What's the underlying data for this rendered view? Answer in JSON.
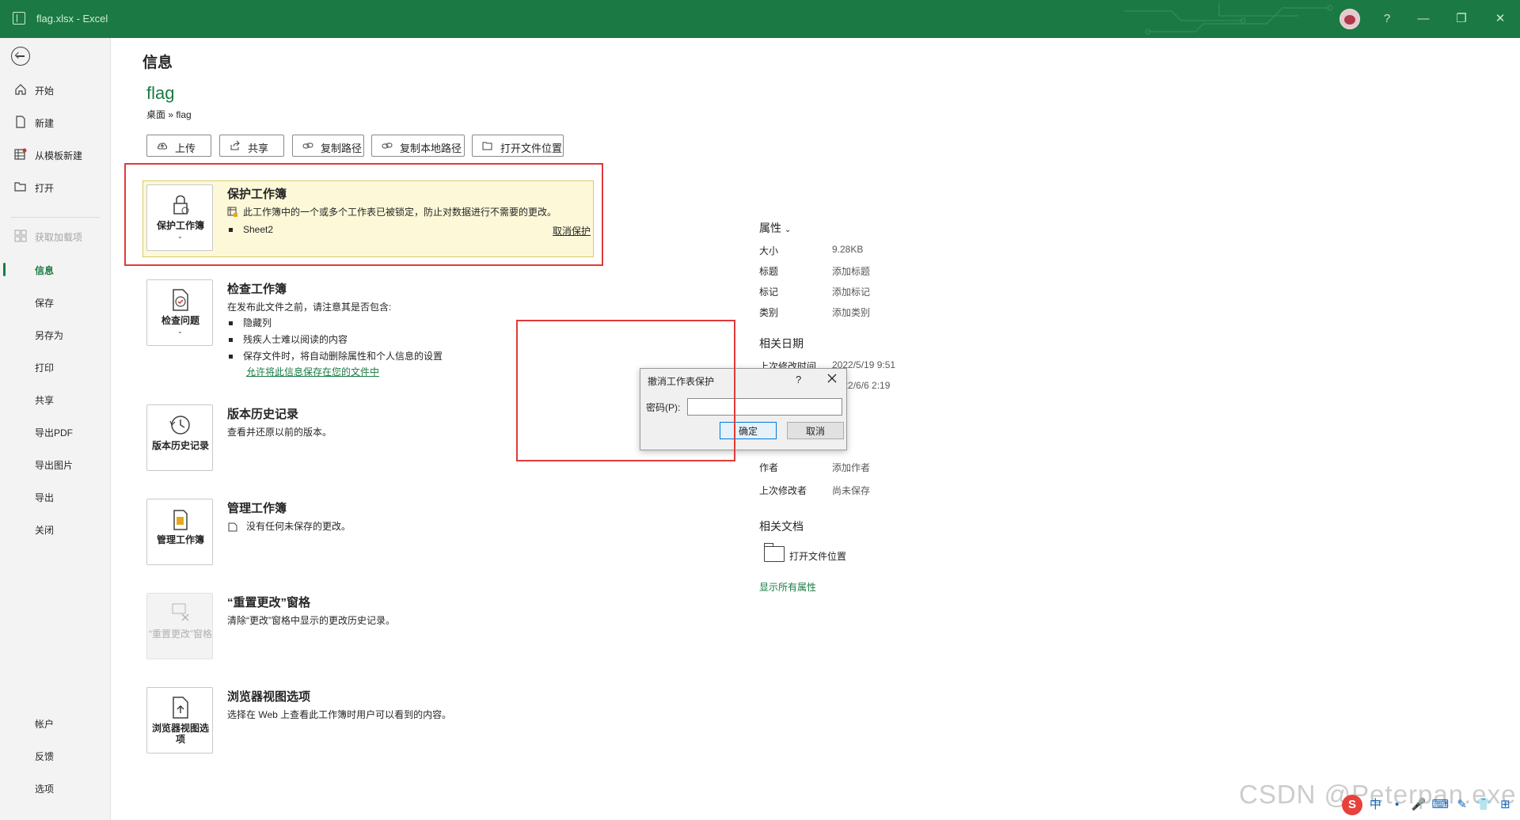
{
  "window": {
    "title": "flag.xlsx  -  Excel",
    "help": "?",
    "minimize": "—",
    "restore": "❐",
    "close": "✕",
    "accent_color": "#1b7a43"
  },
  "nav": {
    "items": [
      {
        "label": "开始",
        "icon": "home-icon"
      },
      {
        "label": "新建",
        "icon": "new-document-icon"
      },
      {
        "label": "从模板新建",
        "icon": "template-icon"
      },
      {
        "label": "打开",
        "icon": "open-folder-icon"
      },
      {
        "label": "获取加载项",
        "icon": "addins-icon"
      },
      {
        "label": "信息"
      },
      {
        "label": "保存"
      },
      {
        "label": "另存为"
      },
      {
        "label": "打印"
      },
      {
        "label": "共享"
      },
      {
        "label": "导出PDF"
      },
      {
        "label": "导出图片"
      },
      {
        "label": "导出"
      },
      {
        "label": "关闭"
      },
      {
        "label": "帐户"
      },
      {
        "label": "反馈"
      },
      {
        "label": "选项"
      }
    ]
  },
  "main": {
    "heading": "信息",
    "file_name": "flag",
    "breadcrumb": "桌面 » flag",
    "buttons": [
      {
        "label": "上传",
        "icon": "upload-icon"
      },
      {
        "label": "共享",
        "icon": "share-icon"
      },
      {
        "label": "复制路径",
        "icon": "link-icon"
      },
      {
        "label": "复制本地路径",
        "icon": "link-icon"
      },
      {
        "label": "打开文件位置",
        "icon": "open-folder-icon"
      }
    ],
    "protect": {
      "tile_label": "保护工作簿",
      "title": "保护工作簿",
      "desc": "此工作簿中的一个或多个工作表已被锁定，防止对数据进行不需要的更改。",
      "sheet": "Sheet2",
      "unprotect_link": "取消保护"
    },
    "inspect": {
      "tile_label": "检查问题",
      "title": "检查工作簿",
      "desc": "在发布此文件之前，请注意其是否包含:",
      "bullets": [
        "隐藏列",
        "残疾人士难以阅读的内容",
        "保存文件时，将自动删除属性和个人信息的设置"
      ],
      "link": "允许将此信息保存在您的文件中"
    },
    "history": {
      "tile_label": "版本历史记录",
      "title": "版本历史记录",
      "desc": "查看并还原以前的版本。"
    },
    "manage": {
      "tile_label": "管理工作簿",
      "title": "管理工作簿",
      "desc": "没有任何未保存的更改。"
    },
    "reset": {
      "tile_label": "“重置更改”窗格",
      "title": "“重置更改”窗格",
      "desc": "清除“更改”窗格中显示的更改历史记录。"
    },
    "browser": {
      "tile_label": "浏览器视图选项",
      "title": "浏览器视图选项",
      "desc": "选择在 Web 上查看此工作簿时用户可以看到的内容。"
    }
  },
  "properties": {
    "heading": "属性",
    "rows": [
      {
        "key": "大小",
        "value": "9.28KB"
      },
      {
        "key": "标题",
        "value": "添加标题"
      },
      {
        "key": "标记",
        "value": "添加标记"
      },
      {
        "key": "类别",
        "value": "添加类别"
      }
    ],
    "dates_heading": "相关日期",
    "dates": [
      {
        "key": "上次修改时间",
        "value": "2022/5/19 9:51"
      },
      {
        "key": "",
        "value": "2022/6/6 2:19"
      }
    ],
    "people": [
      {
        "key": "作者",
        "value": "添加作者"
      },
      {
        "key": "上次修改者",
        "value": "尚未保存"
      }
    ],
    "docs_heading": "相关文档",
    "open_location": "打开文件位置",
    "show_all": "显示所有属性"
  },
  "dialog": {
    "title": "撤消工作表保护",
    "help": "?",
    "password_label": "密码(P):",
    "password_value": "",
    "ok": "确定",
    "cancel": "取消"
  },
  "watermark": "CSDN @Peterpan.exe",
  "ime": [
    "中",
    "•",
    "🎤",
    "⌨",
    "✎",
    "👕",
    "⊞"
  ]
}
